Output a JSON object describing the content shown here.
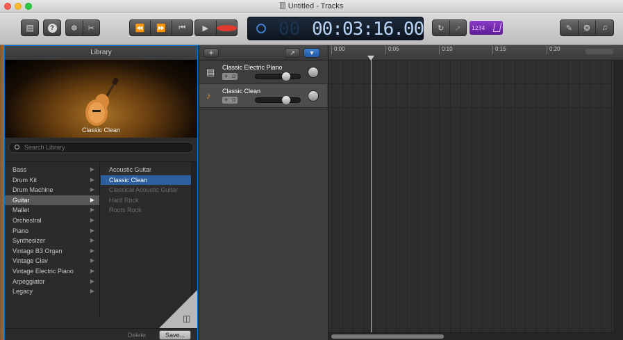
{
  "window": {
    "title": "Untitled - Tracks"
  },
  "toolbar": {
    "lcd_time": "00:03:16.00",
    "lcd_ghost": "00",
    "count_in": "1234"
  },
  "library": {
    "header": "Library",
    "preview_name": "Classic Clean",
    "search_placeholder": "Search Library",
    "categories": [
      {
        "label": "Bass"
      },
      {
        "label": "Drum Kit"
      },
      {
        "label": "Drum Machine"
      },
      {
        "label": "Guitar",
        "selected": true
      },
      {
        "label": "Mallet"
      },
      {
        "label": "Orchestral"
      },
      {
        "label": "Piano"
      },
      {
        "label": "Synthesizer"
      },
      {
        "label": "Vintage B3 Organ"
      },
      {
        "label": "Vintage Clav"
      },
      {
        "label": "Vintage Electric Piano"
      },
      {
        "label": "Arpeggiator"
      },
      {
        "label": "Legacy"
      }
    ],
    "patches": [
      {
        "label": "Acoustic Guitar",
        "state": "normal"
      },
      {
        "label": "Classic Clean",
        "state": "selected"
      },
      {
        "label": "Classical Acoustic Guitar",
        "state": "dim"
      },
      {
        "label": "Hard Rock",
        "state": "dim"
      },
      {
        "label": "Roots Rock",
        "state": "dim"
      }
    ],
    "delete_label": "Delete",
    "save_label": "Save..."
  },
  "tracks": [
    {
      "name": "Classic Electric Piano",
      "icon": "keyboard-icon"
    },
    {
      "name": "Classic Clean",
      "icon": "guitar-icon"
    }
  ],
  "ruler": {
    "marks": [
      "0:00",
      "0:05",
      "0:10",
      "0:15",
      "0:20"
    ]
  },
  "colors": {
    "accent": "#2d5e9d",
    "lcd_text": "#b9d4f5",
    "count_in": "#8a3ac8"
  }
}
